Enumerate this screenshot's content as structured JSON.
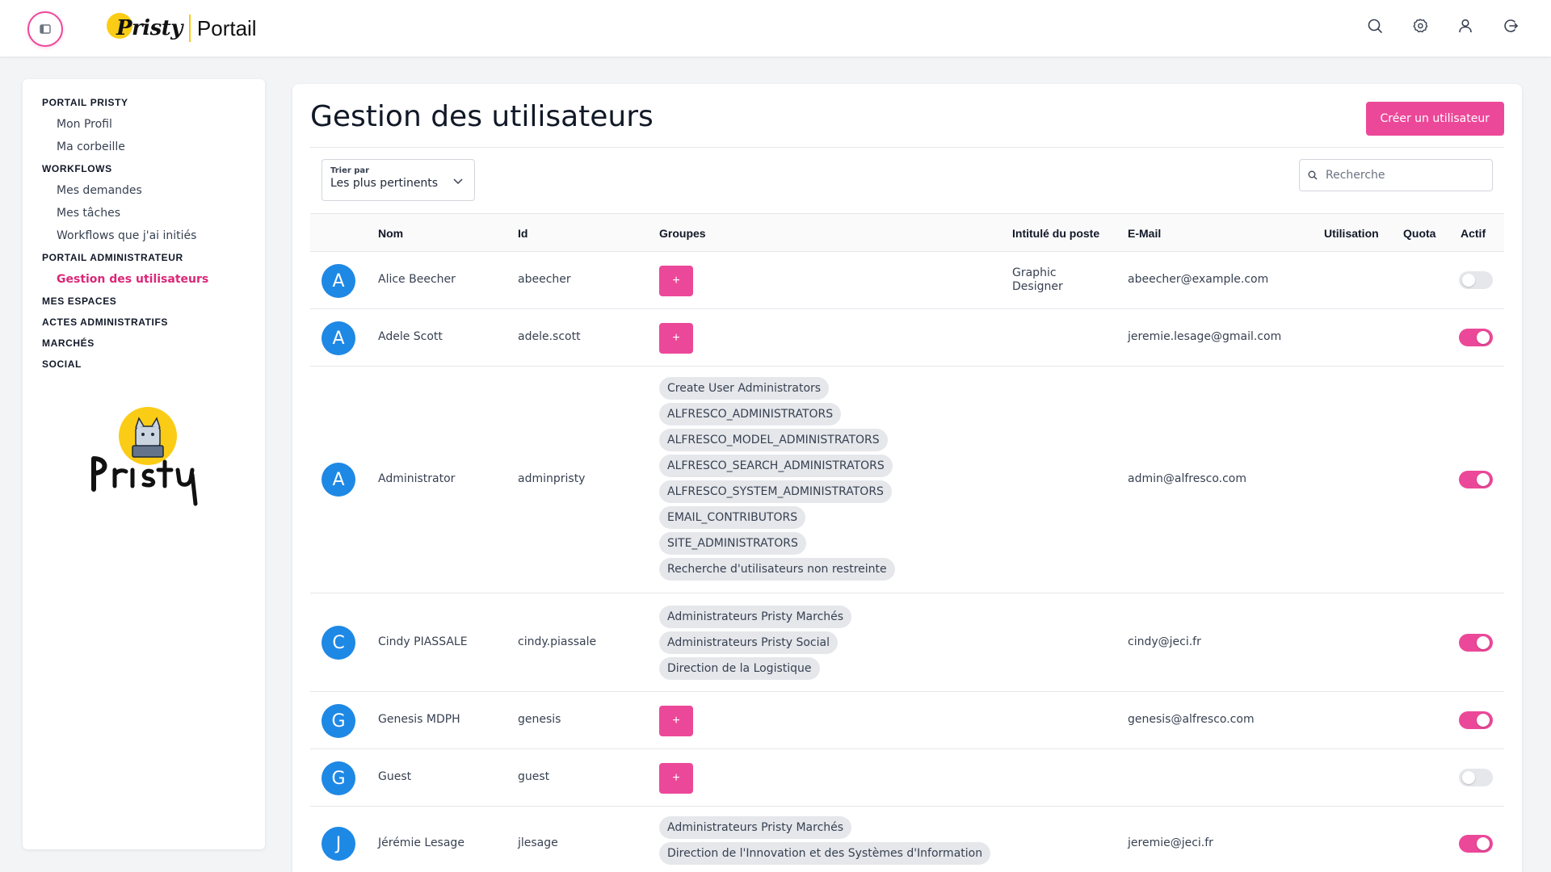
{
  "brand": {
    "name": "Pristy",
    "portal": "Portail"
  },
  "topbar": {
    "icons": [
      "search-icon",
      "settings-icon",
      "user-icon",
      "logout-icon"
    ]
  },
  "colors": {
    "accent": "#ec4899",
    "avatar": "#1e88e5",
    "chip": "#e5e7eb"
  },
  "sidebar": {
    "sections": [
      {
        "title": "PORTAIL PRISTY",
        "items": [
          {
            "label": "Mon Profil"
          },
          {
            "label": "Ma corbeille"
          }
        ]
      },
      {
        "title": "WORKFLOWS",
        "items": [
          {
            "label": "Mes demandes"
          },
          {
            "label": "Mes tâches"
          },
          {
            "label": "Workflows que j'ai initiés"
          }
        ]
      },
      {
        "title": "PORTAIL ADMINISTRATEUR",
        "items": [
          {
            "label": "Gestion des utilisateurs",
            "active": true
          }
        ]
      },
      {
        "title": "MES ESPACES",
        "items": []
      },
      {
        "title": "ACTES ADMINISTRATIFS",
        "items": []
      },
      {
        "title": "MARCHÉS",
        "items": []
      },
      {
        "title": "SOCIAL",
        "items": []
      }
    ]
  },
  "page": {
    "title": "Gestion des utilisateurs",
    "create_button": "Créer un utilisateur",
    "sort": {
      "label": "Trier par",
      "value": "Les plus pertinents"
    },
    "search": {
      "placeholder": "Recherche"
    }
  },
  "table": {
    "columns": [
      "Nom",
      "Id",
      "Groupes",
      "Intitulé du poste",
      "E-Mail",
      "Utilisation",
      "Quota",
      "Actif"
    ],
    "add_group_label": "+",
    "rows": [
      {
        "initial": "A",
        "name": "Alice Beecher",
        "id": "abeecher",
        "groups": [],
        "job": "Graphic Designer",
        "email": "abeecher@example.com",
        "active": false
      },
      {
        "initial": "A",
        "name": "Adele Scott",
        "id": "adele.scott",
        "groups": [],
        "job": "",
        "email": "jeremie.lesage@gmail.com",
        "active": true
      },
      {
        "initial": "A",
        "name": "Administrator",
        "id": "adminpristy",
        "groups": [
          "Create User Administrators",
          "ALFRESCO_ADMINISTRATORS",
          "ALFRESCO_MODEL_ADMINISTRATORS",
          "ALFRESCO_SEARCH_ADMINISTRATORS",
          "ALFRESCO_SYSTEM_ADMINISTRATORS",
          "EMAIL_CONTRIBUTORS",
          "SITE_ADMINISTRATORS",
          "Recherche d'utilisateurs non restreinte"
        ],
        "job": "",
        "email": "admin@alfresco.com",
        "active": true
      },
      {
        "initial": "C",
        "name": "Cindy PIASSALE",
        "id": "cindy.piassale",
        "groups": [
          "Administrateurs Pristy Marchés",
          "Administrateurs Pristy Social",
          "Direction de la Logistique"
        ],
        "job": "",
        "email": "cindy@jeci.fr",
        "active": true
      },
      {
        "initial": "G",
        "name": "Genesis MDPH",
        "id": "genesis",
        "groups": [],
        "job": "",
        "email": "genesis@alfresco.com",
        "active": true
      },
      {
        "initial": "G",
        "name": "Guest",
        "id": "guest",
        "groups": [],
        "job": "",
        "email": "",
        "active": false
      },
      {
        "initial": "J",
        "name": "Jérémie Lesage",
        "id": "jlesage",
        "groups": [
          "Administrateurs Pristy Marchés",
          "Direction de l'Innovation et des Systèmes d'Information"
        ],
        "job": "",
        "email": "jeremie@jeci.fr",
        "active": true
      }
    ]
  }
}
